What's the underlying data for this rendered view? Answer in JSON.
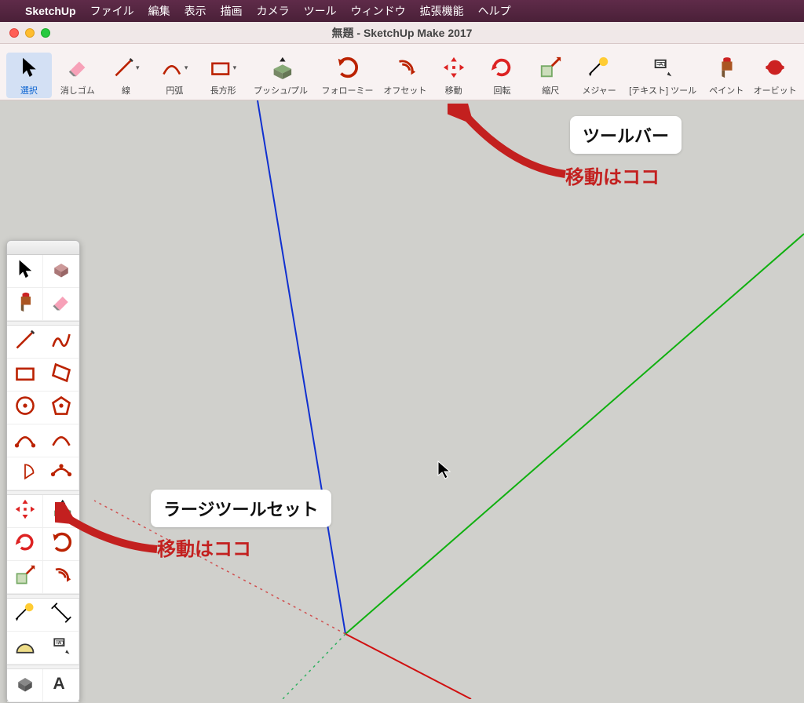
{
  "menubar": {
    "app": "SketchUp",
    "items": [
      "ファイル",
      "編集",
      "表示",
      "描画",
      "カメラ",
      "ツール",
      "ウィンドウ",
      "拡張機能",
      "ヘルプ"
    ]
  },
  "window": {
    "title": "無題 - SketchUp Make 2017"
  },
  "toolbar": {
    "items": [
      {
        "id": "select",
        "label": "選択",
        "selected": true
      },
      {
        "id": "eraser",
        "label": "消しゴム"
      },
      {
        "id": "line",
        "label": "線",
        "dd": true
      },
      {
        "id": "arc",
        "label": "円弧",
        "dd": true
      },
      {
        "id": "rect",
        "label": "長方形",
        "dd": true
      },
      {
        "id": "pushpull",
        "label": "プッシュ/プル",
        "wide": true
      },
      {
        "id": "followme",
        "label": "フォローミー",
        "wide": true
      },
      {
        "id": "offset",
        "label": "オフセット"
      },
      {
        "id": "move",
        "label": "移動"
      },
      {
        "id": "rotate",
        "label": "回転"
      },
      {
        "id": "scale",
        "label": "縮尺"
      },
      {
        "id": "measure",
        "label": "メジャー"
      },
      {
        "id": "text",
        "label": "[テキスト] ツール",
        "wider": true
      },
      {
        "id": "paint",
        "label": "ペイント"
      },
      {
        "id": "orbit",
        "label": "オービット"
      }
    ]
  },
  "palette": {
    "cells": [
      "select",
      "make-component",
      "paint",
      "eraser",
      "SEP",
      "line",
      "freehand",
      "rect",
      "rect-rot",
      "circle",
      "polygon",
      "arc-2pt",
      "arc",
      "arc-pie",
      "arc-3pt",
      "SEP",
      "move",
      "pushpull",
      "rotate",
      "followme",
      "scale",
      "offset",
      "SEP",
      "measure",
      "dimension",
      "protractor",
      "text",
      "SEP",
      "3dtext",
      "3dtext-a"
    ]
  },
  "annotations": {
    "toolbar_label": "ツールバー",
    "toolbar_note": "移動はココ",
    "large_toolset_label": "ラージツールセット",
    "large_toolset_note": "移動はココ"
  }
}
